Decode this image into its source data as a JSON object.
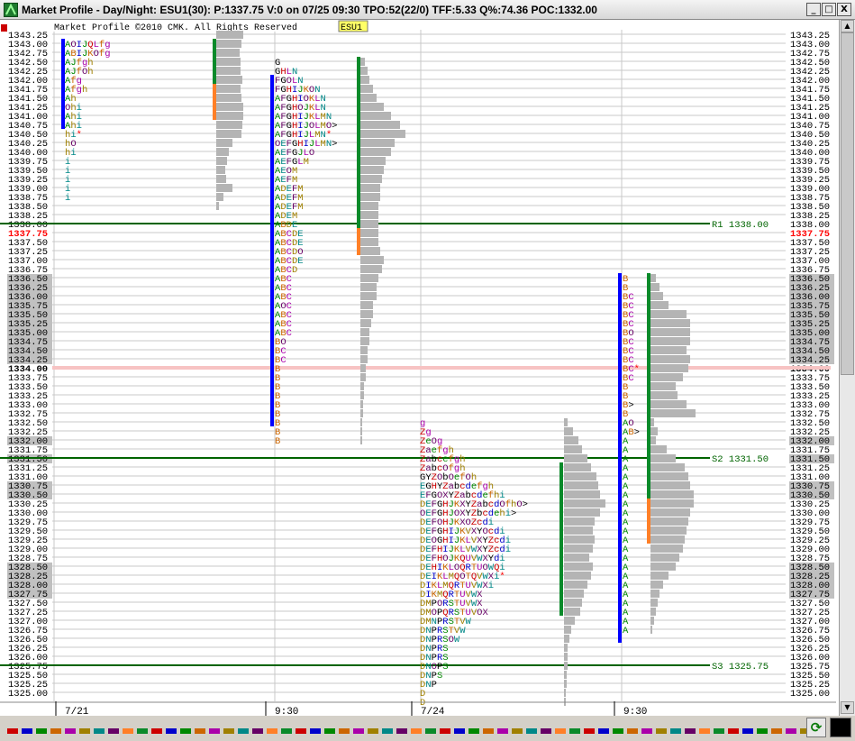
{
  "window": {
    "title": "Market Profile - Day/Night: ESU1(30): P:1337.75 V:0 on 07/25 09:30 TPO:52(22/0)  TFF:5.33 Q%:74.36 POC:1332.00",
    "buttons": [
      "_",
      "□",
      "X"
    ]
  },
  "chart": {
    "copyright": "Market Profile ©2010 CMK. All Rights Reserved",
    "symbol_tag": "ESU1",
    "current_price": "1337.75",
    "highlight_price": "1334.00",
    "price_labels": [
      "1343.25",
      "1343.00",
      "1342.75",
      "1342.50",
      "1342.25",
      "1342.00",
      "1341.75",
      "1341.50",
      "1341.25",
      "1341.00",
      "1340.75",
      "1340.50",
      "1340.25",
      "1340.00",
      "1339.75",
      "1339.50",
      "1339.25",
      "1339.00",
      "1338.75",
      "1338.50",
      "1338.25",
      "1338.00",
      "1337.75",
      "1337.50",
      "1337.25",
      "1337.00",
      "1336.75",
      "1336.50",
      "1336.25",
      "1336.00",
      "1335.75",
      "1335.50",
      "1335.25",
      "1335.00",
      "1334.75",
      "1334.50",
      "1334.25",
      "1334.00",
      "1333.75",
      "1333.50",
      "1333.25",
      "1333.00",
      "1332.75",
      "1332.50",
      "1332.25",
      "1332.00",
      "1331.75",
      "1331.50",
      "1331.25",
      "1331.00",
      "1330.75",
      "1330.50",
      "1330.25",
      "1330.00",
      "1329.75",
      "1329.50",
      "1329.25",
      "1329.00",
      "1328.75",
      "1328.50",
      "1328.25",
      "1328.00",
      "1327.75",
      "1327.50",
      "1327.25",
      "1327.00",
      "1326.75",
      "1326.50",
      "1326.25",
      "1326.00",
      "1325.75",
      "1325.50",
      "1325.25",
      "1325.00"
    ],
    "levels": [
      {
        "label": "R1  1338.00",
        "price": 1338.0
      },
      {
        "label": "S2  1331.50",
        "price": 1331.5
      },
      {
        "label": "S3  1325.75",
        "price": 1325.75
      }
    ],
    "x_labels": [
      "7/21",
      "9:30",
      "7/24",
      "9:30"
    ],
    "profiles": [
      {
        "name": "7/21 night",
        "top": 1343.0,
        "rows": [
          "AOIJQLfg",
          "ABIJKOfg",
          "AJfgh",
          "AJfOh",
          "Afg",
          "Afgh",
          "Ah",
          "Ohi",
          "Ahi",
          "Ahi",
          "hi*",
          "hO",
          "hi",
          "i",
          "i",
          "i",
          "i",
          "i"
        ]
      },
      {
        "name": "7/21 day",
        "top": 1342.5,
        "rows": [
          "G",
          "GHLN",
          "FGOLN",
          "FGHIJKON",
          "AFGHIOKLN",
          "AFGHOJKLN",
          "AFGHIJKLMN",
          "AFGHIJOLMO>",
          "AFGHIJLMN*",
          "OEFGHIJLMN>",
          "AEFGJLO",
          "AEFGLM",
          "AEOM",
          "AEFM",
          "ADEFM",
          "ADEFM",
          "ADEFM",
          "ADEM",
          "ABDE",
          "ABCDE",
          "ABCDE",
          "ABCDO",
          "ABCDE",
          "ABCD",
          "ABC",
          "ABC",
          "ABC",
          "AOC",
          "ABC",
          "ABC",
          "ABC",
          "BO",
          "BC",
          "BC",
          "B",
          "B",
          "B",
          "B",
          "B",
          "B",
          "B",
          "B",
          "B"
        ]
      },
      {
        "name": "7/24 night",
        "top": 1332.5,
        "rows": [
          "g",
          "Zg",
          "ZeOg",
          "Zaefgh",
          "Zabcefgh",
          "ZabcOfgh",
          "GYZObOefOh",
          "EGHYZabcdefgh",
          "EFGOXYZabcdefhi",
          "DEFGHJKXYZabcdOfhO>",
          "OEFGHJOXYZbcdehi>",
          "DEFOHJKXOZcdi",
          "DEFGHIJKVXYOcdi",
          "DEOGHIJKLVXYZcdi",
          "DEFHIJKLVWXYZcdi",
          "DEFHOJKQUVWXYdi",
          "DEHIKLOQRTUOWQi",
          "DEIKLMQOTQVWXi*",
          "DIKLMQRTUVWXi",
          "DIKMQRTUVWX",
          "DMPORSTUVWX",
          "DMOPQRSTUVOX",
          "DMNPRSTVW",
          "DNPRSTVW",
          "DNPRSOW",
          "DNPRS",
          "DNPRS",
          "DNOPS",
          "DNPS",
          "DNP",
          "D",
          "D"
        ]
      },
      {
        "name": "7/25 day",
        "top": 1336.5,
        "rows": [
          "B",
          "B",
          "BC",
          "BC",
          "BC",
          "BC",
          "BO",
          "BC",
          "BC",
          "BC",
          "BC*",
          "BC",
          "B",
          "B",
          "B>",
          "B",
          "AO",
          "AB>",
          "A",
          "A",
          "A",
          "A",
          "A",
          "A",
          "A",
          "A",
          "A",
          "A",
          "A",
          "A",
          "A",
          "A",
          "A",
          "A",
          "A",
          "A",
          "A",
          "A",
          "A",
          "A"
        ]
      }
    ],
    "colors": {
      "background": "#ffffff",
      "grid": "#c8c8c8",
      "level_line": "#006400",
      "axis_highlight": "#c0c0c0",
      "current_price": "#ff0000",
      "volume_bar": "#b4b4b4",
      "value_area_blue": "#0000ff",
      "value_area_green": "#0a8a2a",
      "value_area_orange": "#ff7f27"
    }
  }
}
